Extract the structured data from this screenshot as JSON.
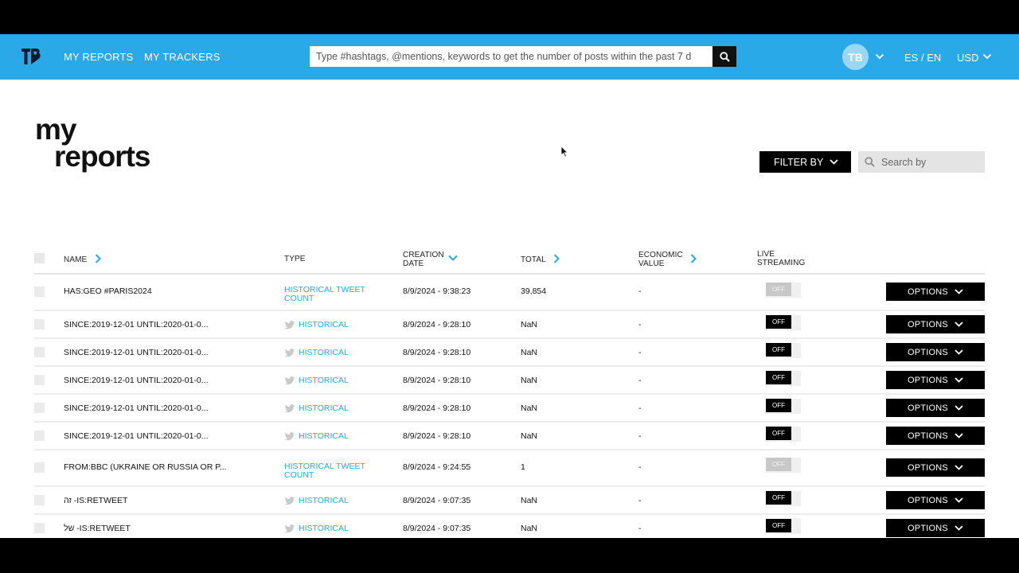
{
  "nav": {
    "my_reports": "MY REPORTS",
    "my_trackers": "MY TRACKERS",
    "search_placeholder": "Type #hashtags, @mentions, keywords to get the number of posts within the past 7 d",
    "avatar_initials": "TB",
    "lang_es": "ES",
    "lang_sep": " / ",
    "lang_en": "EN",
    "currency": "USD"
  },
  "page": {
    "title_line1": "my",
    "title_line2": "reports",
    "filter_label": "FILTER BY",
    "search_placeholder": "Search by"
  },
  "table": {
    "headers": {
      "name": "NAME",
      "type": "TYPE",
      "creation_line1": "CREATION",
      "creation_line2": "DATE",
      "total": "TOTAL",
      "economic_line1": "ECONOMIC",
      "economic_line2": "VALUE",
      "live_line1": "LIVE",
      "live_line2": "STREAMING"
    },
    "options_label": "OPTIONS",
    "rows": [
      {
        "name": "HAS:GEO #PARIS2024",
        "type_line1": "HISTORICAL TWEET",
        "type_line2": "COUNT",
        "date": "8/9/2024 - 9:38:23",
        "total": "39,854",
        "value": "-",
        "live": "OFF"
      },
      {
        "name": "SINCE:2019-12-01 UNTIL:2020-01-0...",
        "type_line1": "HISTORICAL",
        "type_line2": "",
        "date": "8/9/2024 - 9:28:10",
        "total": "NaN",
        "value": "-",
        "live": "OFF"
      },
      {
        "name": "SINCE:2019-12-01 UNTIL:2020-01-0...",
        "type_line1": "HISTORICAL",
        "type_line2": "",
        "date": "8/9/2024 - 9:28:10",
        "total": "NaN",
        "value": "-",
        "live": "OFF"
      },
      {
        "name": "SINCE:2019-12-01 UNTIL:2020-01-0...",
        "type_line1": "HISTORICAL",
        "type_line2": "",
        "date": "8/9/2024 - 9:28:10",
        "total": "NaN",
        "value": "-",
        "live": "OFF"
      },
      {
        "name": "SINCE:2019-12-01 UNTIL:2020-01-0...",
        "type_line1": "HISTORICAL",
        "type_line2": "",
        "date": "8/9/2024 - 9:28:10",
        "total": "NaN",
        "value": "-",
        "live": "OFF"
      },
      {
        "name": "SINCE:2019-12-01 UNTIL:2020-01-0...",
        "type_line1": "HISTORICAL",
        "type_line2": "",
        "date": "8/9/2024 - 9:28:10",
        "total": "NaN",
        "value": "-",
        "live": "OFF"
      },
      {
        "name": "FROM:BBC (UKRAINE OR RUSSIA OR P...",
        "type_line1": "HISTORICAL TWEET",
        "type_line2": "COUNT",
        "date": "8/9/2024 - 9:24:55",
        "total": "1",
        "value": "-",
        "live": "OFF"
      },
      {
        "name": "זה -IS:RETWEET",
        "type_line1": "HISTORICAL",
        "type_line2": "",
        "date": "8/9/2024 - 9:07:35",
        "total": "NaN",
        "value": "-",
        "live": "OFF"
      },
      {
        "name": "של -IS:RETWEET",
        "type_line1": "HISTORICAL",
        "type_line2": "",
        "date": "8/9/2024 - 9:07:35",
        "total": "NaN",
        "value": "-",
        "live": "OFF"
      }
    ]
  },
  "colors": {
    "brand_blue": "#29a9e8",
    "button_black": "#000000"
  }
}
